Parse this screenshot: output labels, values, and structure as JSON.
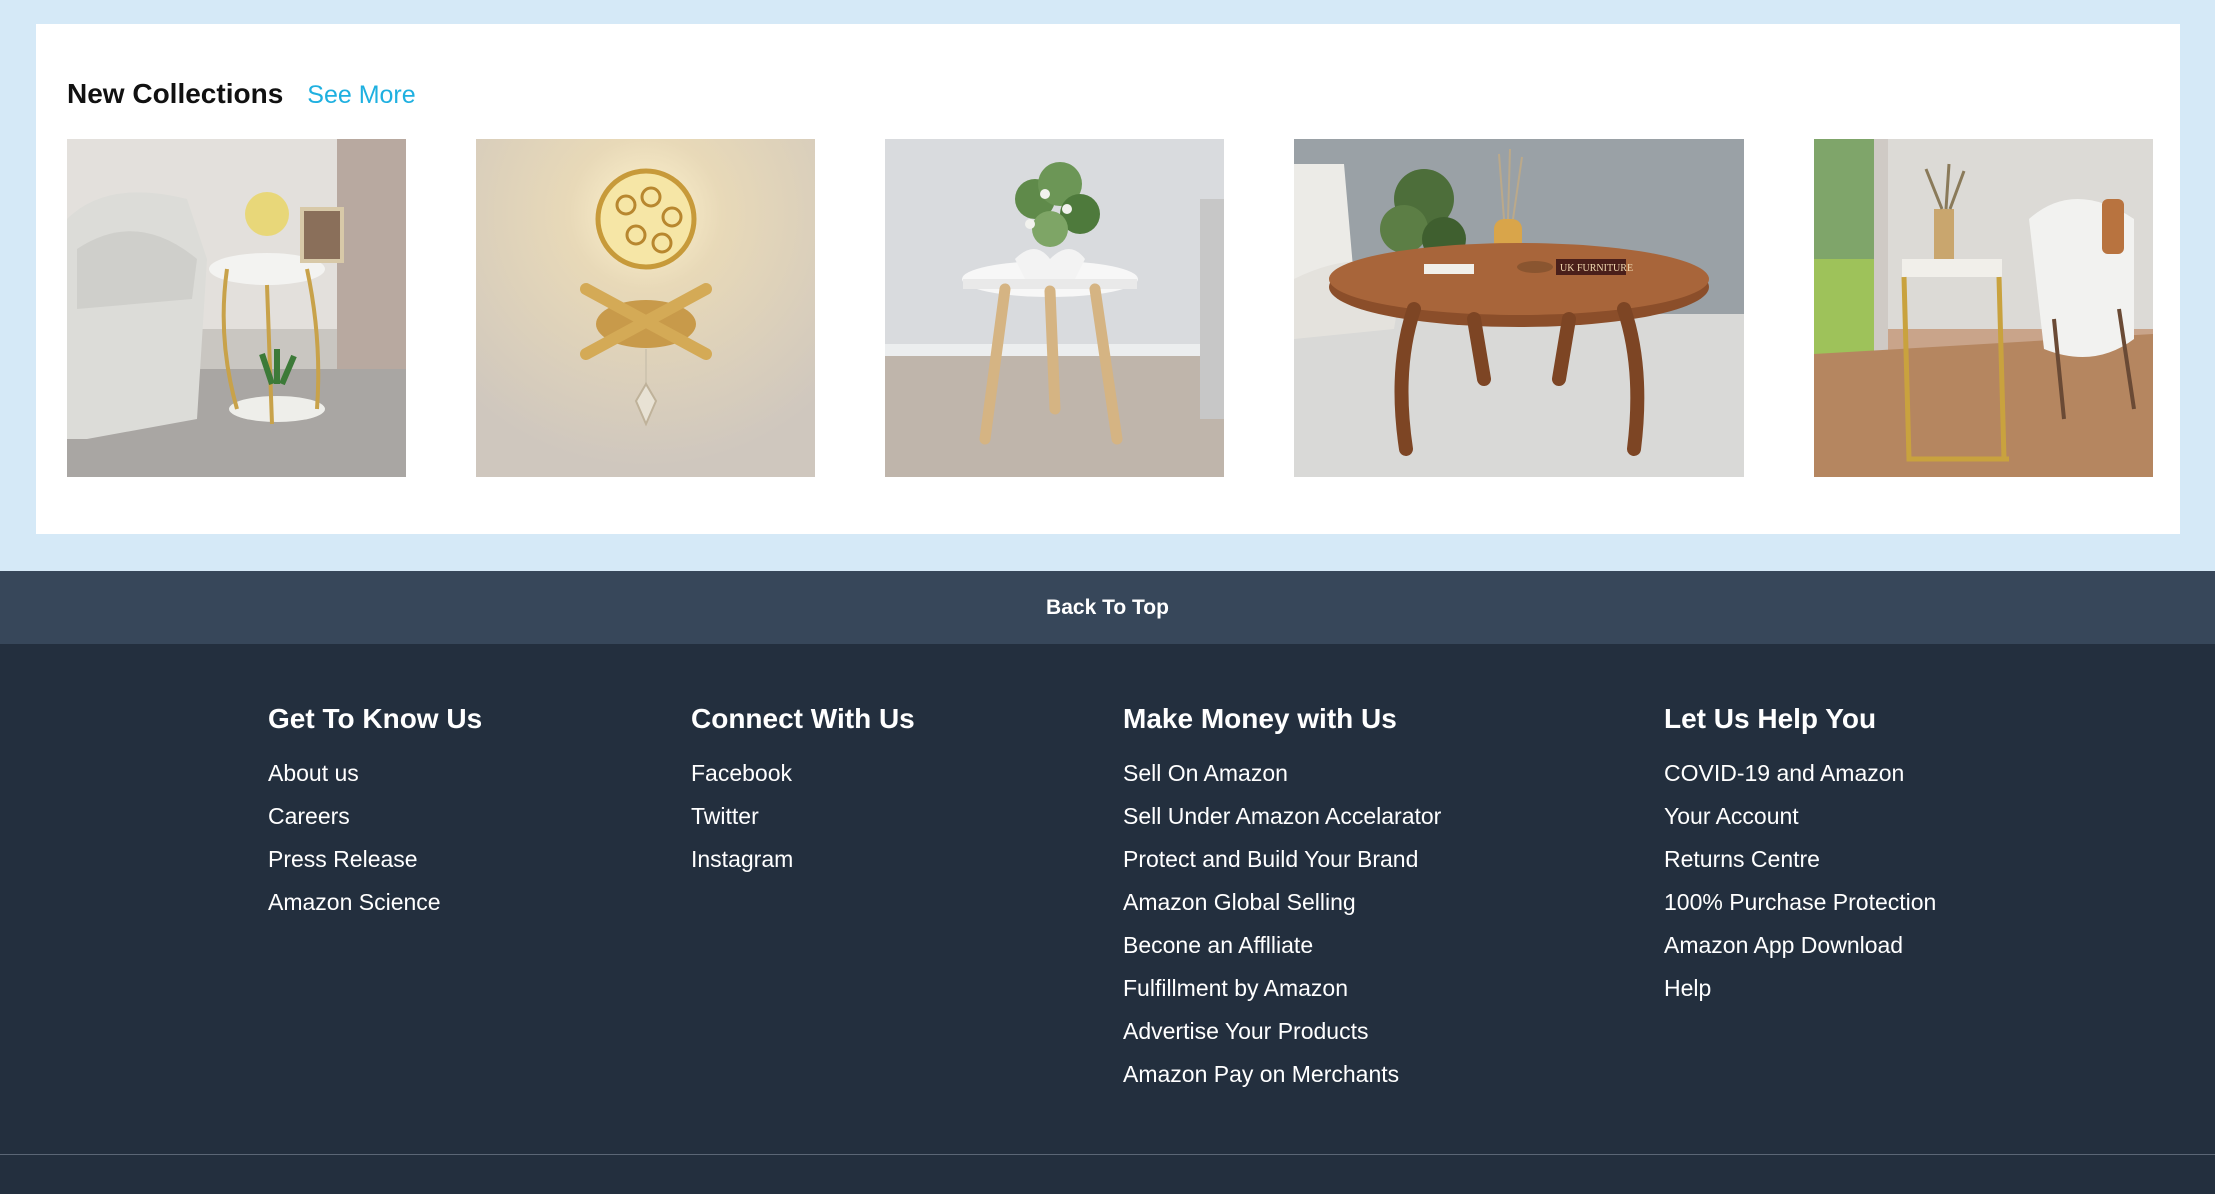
{
  "collections": {
    "title": "New Collections",
    "see_more": "See More",
    "products": [
      {
        "name": "gold-side-table-with-plants"
      },
      {
        "name": "crystal-wall-lamp"
      },
      {
        "name": "white-round-side-table"
      },
      {
        "name": "wooden-coffee-table"
      },
      {
        "name": "gold-c-shaped-side-table"
      }
    ],
    "product_badge": "UK FURNITURE"
  },
  "back_to_top": "Back To Top",
  "footer": {
    "columns": [
      {
        "title": "Get To Know Us",
        "links": [
          "About us",
          "Careers",
          "Press Release",
          "Amazon Science"
        ]
      },
      {
        "title": "Connect With Us",
        "links": [
          "Facebook",
          "Twitter",
          "Instagram"
        ]
      },
      {
        "title": "Make Money with Us",
        "links": [
          "Sell On Amazon",
          "Sell Under Amazon Accelarator",
          "Protect and Build Your Brand",
          "Amazon Global Selling",
          "Becone an Afflliate",
          "Fulfillment by Amazon",
          "Advertise Your Products",
          "Amazon Pay on Merchants"
        ]
      },
      {
        "title": "Let Us Help You",
        "links": [
          "COVID-19 and Amazon",
          "Your Account",
          "Returns Centre",
          "100% Purchase Protection",
          "Amazon App Download",
          "Help"
        ]
      }
    ]
  },
  "colors": {
    "page_bg": "#d5e9f7",
    "back_to_top_bg": "#37475a",
    "footer_bg": "#232f3e",
    "link_accent": "#1fb0e0"
  }
}
